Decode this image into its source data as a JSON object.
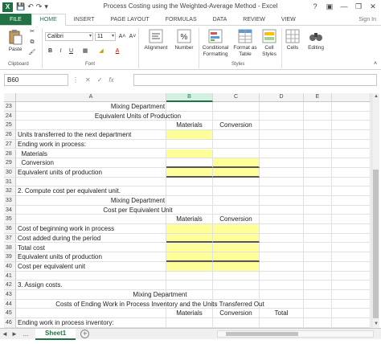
{
  "window": {
    "title": "Process Costing using the Weighted-Average Method - Excel",
    "help": "?",
    "logo": "X"
  },
  "ribbon": {
    "tabs": [
      {
        "label": "FILE"
      },
      {
        "label": "HOME"
      },
      {
        "label": "INSERT"
      },
      {
        "label": "PAGE LAYOUT"
      },
      {
        "label": "FORMULAS"
      },
      {
        "label": "DATA"
      },
      {
        "label": "REVIEW"
      },
      {
        "label": "VIEW"
      }
    ],
    "active_tab": "HOME",
    "sign_in": "Sign In",
    "paste_label": "Paste",
    "clipboard_label": "Clipboard",
    "font_label": "Font",
    "font_name": "Calibri",
    "font_size": "11",
    "bold": "B",
    "italic": "I",
    "underline": "U",
    "grow_font": "A˄",
    "shrink_font": "A˅",
    "font_color": "A",
    "alignment_label": "Alignment",
    "number_label": "Number",
    "number_symbol": "%",
    "cond_format_label": "Conditional Formatting",
    "format_table_label": "Format as Table",
    "cell_styles_label": "Cell Styles",
    "styles_label": "Styles",
    "cells_label": "Cells",
    "editing_label": "Editing"
  },
  "formula_bar": {
    "name_box": "B60",
    "cancel": "✕",
    "enter": "✓",
    "fx": "fx",
    "value": ""
  },
  "columns": [
    "A",
    "B",
    "C",
    "D",
    "E"
  ],
  "selected_column": "B",
  "rows": [
    {
      "num": "23",
      "a": "",
      "center_text": "Mixing Department",
      "center_span": "A",
      "b": "",
      "c": "",
      "d": ""
    },
    {
      "num": "24",
      "a": "",
      "center_text": "Equivalent Units of Production",
      "center_span": "A",
      "b": "",
      "c": "",
      "d": ""
    },
    {
      "num": "25",
      "a": "",
      "b": "Materials",
      "c": "Conversion",
      "d": ""
    },
    {
      "num": "26",
      "a": "Units transferred to the next department",
      "b": "",
      "c": "",
      "d": "",
      "yb": true
    },
    {
      "num": "27",
      "a": "Ending work in process:",
      "b": "",
      "c": "",
      "d": ""
    },
    {
      "num": "28",
      "a": "  Materials",
      "b": "",
      "c": "",
      "d": "",
      "yb": true
    },
    {
      "num": "29",
      "a": "  Conversion",
      "b": "",
      "c": "",
      "d": "",
      "yc": true,
      "tbb": true,
      "tbc": true
    },
    {
      "num": "30",
      "a": "Equivalent units of production",
      "b": "",
      "c": "",
      "d": "",
      "yb": true,
      "yc": true,
      "tbb": true,
      "tbc": true
    },
    {
      "num": "31",
      "a": "",
      "b": "",
      "c": "",
      "d": ""
    },
    {
      "num": "32",
      "a": "2. Compute cost per equivalent unit.",
      "b": "",
      "c": "",
      "d": ""
    },
    {
      "num": "33",
      "a": "",
      "center_text": "Mixing Department",
      "center_span": "A",
      "b": "",
      "c": "",
      "d": ""
    },
    {
      "num": "34",
      "a": "",
      "center_text": "Cost per Equivalent Unit",
      "center_span": "A",
      "b": "",
      "c": "",
      "d": ""
    },
    {
      "num": "35",
      "a": "",
      "b": "Materials",
      "c": "Conversion",
      "d": ""
    },
    {
      "num": "36",
      "a": "Cost of beginning work in process",
      "b": "",
      "c": "",
      "d": "",
      "yb": true,
      "yc": true
    },
    {
      "num": "37",
      "a": "Cost added during the period",
      "b": "",
      "c": "",
      "d": "",
      "yb": true,
      "yc": true,
      "tbb": true,
      "tbc": true
    },
    {
      "num": "38",
      "a": "Total cost",
      "b": "",
      "c": "",
      "d": "",
      "yb": true,
      "yc": true
    },
    {
      "num": "39",
      "a": "Equivalent units of production",
      "b": "",
      "c": "",
      "d": "",
      "yb": true,
      "yc": true,
      "tbb": true,
      "tbc": true
    },
    {
      "num": "40",
      "a": "Cost per equivalent unit",
      "b": "",
      "c": "",
      "d": "",
      "yb": true,
      "yc": true
    },
    {
      "num": "41",
      "a": "",
      "b": "",
      "c": "",
      "d": ""
    },
    {
      "num": "42",
      "a": "3. Assign costs.",
      "b": "",
      "c": "",
      "d": ""
    },
    {
      "num": "43",
      "a": "",
      "center_text": "Mixing Department",
      "center_span": "AD",
      "b": "",
      "c": "",
      "d": ""
    },
    {
      "num": "44",
      "a": "",
      "center_text": "Costs of Ending Work in Process Inventory and the Units Transferred Out",
      "center_span": "AD",
      "b": "",
      "c": "",
      "d": ""
    },
    {
      "num": "45",
      "a": "",
      "b": "Materials",
      "c": "Conversion",
      "d": "Total"
    },
    {
      "num": "46",
      "a": "Ending work in process inventory:",
      "b": "",
      "c": "",
      "d": ""
    }
  ],
  "sheets": {
    "active": "Sheet1",
    "nav_prev": "◄",
    "nav_next": "►",
    "ellipsis": "...",
    "add": "+"
  }
}
